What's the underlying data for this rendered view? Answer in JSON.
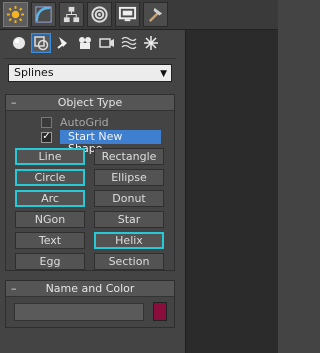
{
  "tabs": [
    {
      "name": "create-tab",
      "icon": "create-icon"
    },
    {
      "name": "modify-tab",
      "icon": "modify-icon"
    },
    {
      "name": "hierarchy-tab",
      "icon": "hierarchy-icon"
    },
    {
      "name": "motion-tab",
      "icon": "motion-icon"
    },
    {
      "name": "display-tab",
      "icon": "display-icon"
    },
    {
      "name": "utilities-tab",
      "icon": "utilities-icon"
    }
  ],
  "category_icons": [
    "geometry-icon",
    "shapes-icon",
    "lights-icon",
    "cameras-icon",
    "helpers-icon",
    "space-warps-icon",
    "systems-icon"
  ],
  "dropdown": {
    "value": "Splines"
  },
  "object_type": {
    "title": "Object Type",
    "autogrid_label": "AutoGrid",
    "autogrid_checked": false,
    "start_new_shape_label": "Start New Shape",
    "start_new_shape_checked": true,
    "buttons": [
      {
        "label": "Line",
        "highlighted": true
      },
      {
        "label": "Rectangle",
        "highlighted": false
      },
      {
        "label": "Circle",
        "highlighted": true
      },
      {
        "label": "Ellipse",
        "highlighted": false
      },
      {
        "label": "Arc",
        "highlighted": true
      },
      {
        "label": "Donut",
        "highlighted": false
      },
      {
        "label": "NGon",
        "highlighted": false
      },
      {
        "label": "Star",
        "highlighted": false
      },
      {
        "label": "Text",
        "highlighted": false
      },
      {
        "label": "Helix",
        "highlighted": true
      },
      {
        "label": "Egg",
        "highlighted": false
      },
      {
        "label": "Section",
        "highlighted": false
      }
    ]
  },
  "name_and_color": {
    "title": "Name and Color",
    "name_value": "",
    "color": "#8b0d3c"
  },
  "colors": {
    "accent_highlight": "#27c9d6",
    "selection_blue": "#3e80cf"
  }
}
